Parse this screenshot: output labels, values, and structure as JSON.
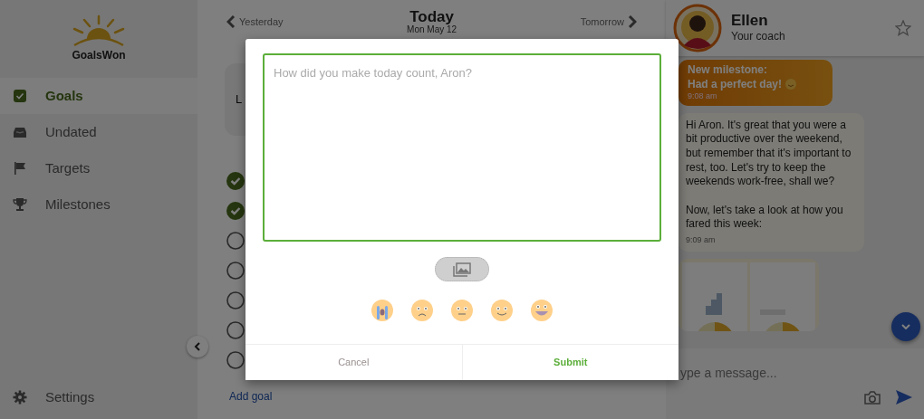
{
  "app": {
    "logo_text": "GoalsWon"
  },
  "sidebar": {
    "items": [
      {
        "label": "Goals",
        "selected": true
      },
      {
        "label": "Undated",
        "selected": false
      },
      {
        "label": "Targets",
        "selected": false
      },
      {
        "label": "Milestones",
        "selected": false
      }
    ],
    "settings": "Settings"
  },
  "day_nav": {
    "prev": "Yesterday",
    "title": "Today",
    "date": "Mon May 12",
    "next": "Tomorrow"
  },
  "summary_card": {
    "text": "L"
  },
  "goals": [
    {
      "checked": true
    },
    {
      "checked": true
    },
    {
      "checked": false
    },
    {
      "checked": false
    },
    {
      "checked": false
    },
    {
      "checked": false
    },
    {
      "checked": false
    }
  ],
  "add_goal": "Add goal",
  "coach": {
    "name": "Ellen",
    "role": "Your coach",
    "starred": false
  },
  "messages": [
    {
      "kind": "milestone",
      "title": "New milestone:",
      "text": "Had a perfect day!",
      "time": "9:08 am"
    },
    {
      "kind": "text",
      "paragraphs": [
        "Hi Aron. It's great that you were a bit productive over the weekend, but remember that it's important to rest, too. Let's try to keep the weekends work-free, shall we?",
        "Now, let's take a look at how you fared this week:"
      ],
      "time": "9:09 am"
    },
    {
      "kind": "picture"
    }
  ],
  "message_input": {
    "placeholder": "ype a message..."
  },
  "modal": {
    "placeholder": "How did you make today count, Aron?",
    "moods": [
      {
        "kind": "crying"
      },
      {
        "kind": "sad"
      },
      {
        "kind": "neutral"
      },
      {
        "kind": "smile"
      },
      {
        "kind": "grin"
      }
    ],
    "cancel": "Cancel",
    "submit": "Submit"
  }
}
